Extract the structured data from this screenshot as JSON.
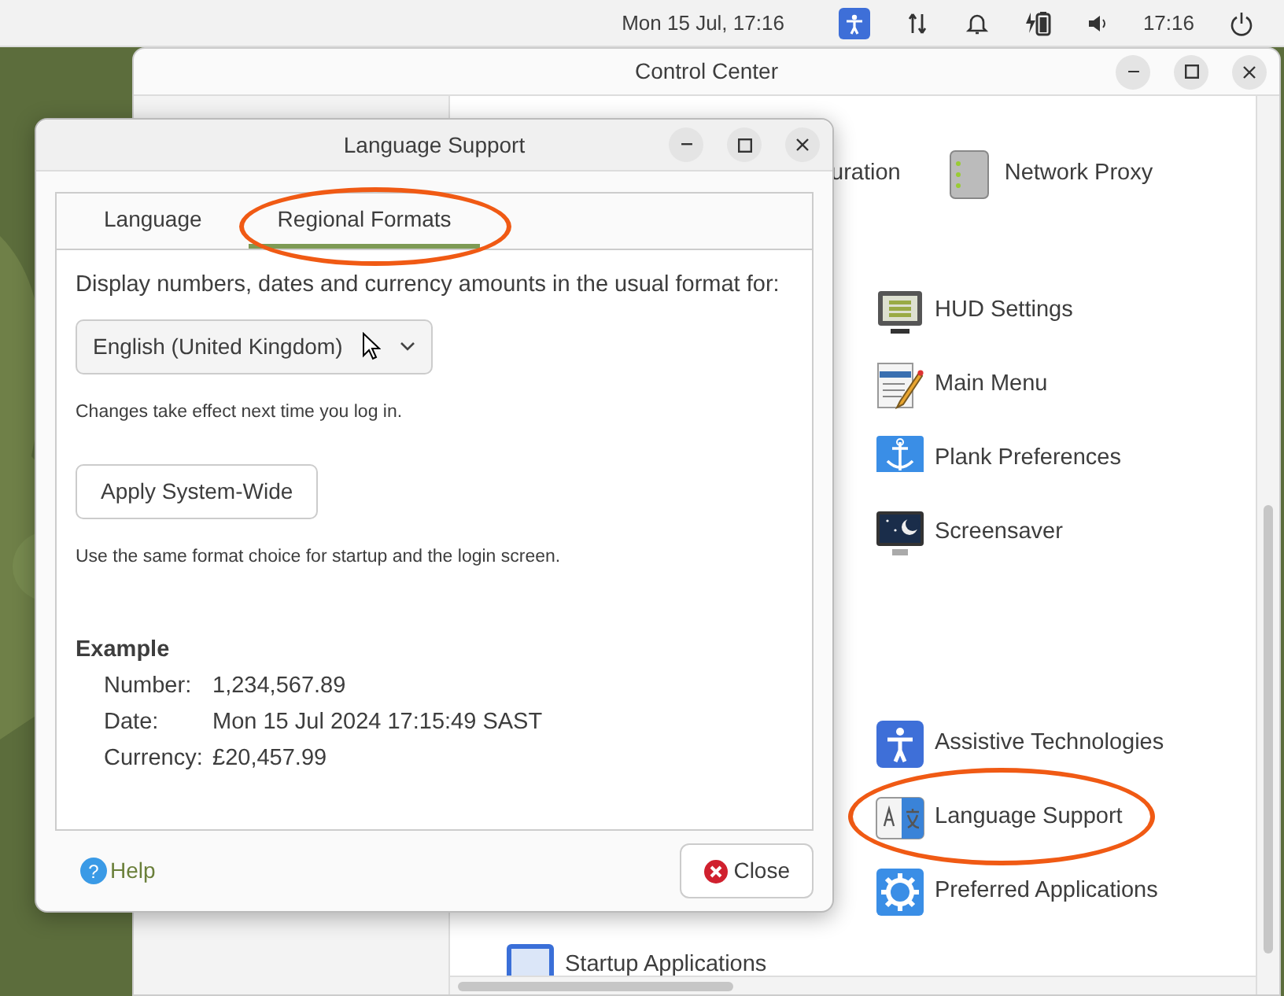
{
  "top_bar": {
    "date": "Mon 15 Jul, 17:16",
    "time": "17:16"
  },
  "control_center": {
    "title": "Control Center",
    "groups": [
      {
        "kind": "row",
        "items": [
          {
            "label": "uration",
            "circled": false
          },
          {
            "label": "Network Proxy",
            "circled": false
          }
        ]
      },
      {
        "kind": "column",
        "items": [
          {
            "label": "HUD Settings",
            "circled": false
          },
          {
            "label": "Main Menu",
            "circled": false
          },
          {
            "label": "Plank Preferences",
            "circled": false
          },
          {
            "label": "Screensaver",
            "circled": false
          }
        ]
      },
      {
        "kind": "column",
        "items": [
          {
            "label": "Assistive Technologies",
            "circled": false
          },
          {
            "label": "Language Support",
            "circled": true
          },
          {
            "label": "Preferred Applications",
            "circled": false
          }
        ]
      },
      {
        "kind": "indent",
        "items": [
          {
            "label": "Startup Applications",
            "circled": false
          }
        ]
      }
    ]
  },
  "dialog": {
    "title": "Language Support",
    "tabs": [
      {
        "label": "Language",
        "selected": false,
        "circled": false
      },
      {
        "label": "Regional Formats",
        "selected": true,
        "circled": true
      }
    ],
    "prompt": "Display numbers, dates and currency amounts in the usual format for:",
    "format_select": {
      "value": "English (United Kingdom)"
    },
    "note": "Changes take effect next time you log in.",
    "apply_button": "Apply System-Wide",
    "apply_note": "Use the same format choice for startup and the login screen.",
    "example": {
      "heading": "Example",
      "rows": [
        {
          "label": "Number:",
          "value": "1,234,567.89"
        },
        {
          "label": "Date:",
          "value": "Mon 15 Jul 2024 17:15:49 SAST"
        },
        {
          "label": "Currency:",
          "value": "£20,457.99"
        }
      ]
    },
    "help_icon": "?",
    "help": "Help",
    "close": "Close"
  }
}
